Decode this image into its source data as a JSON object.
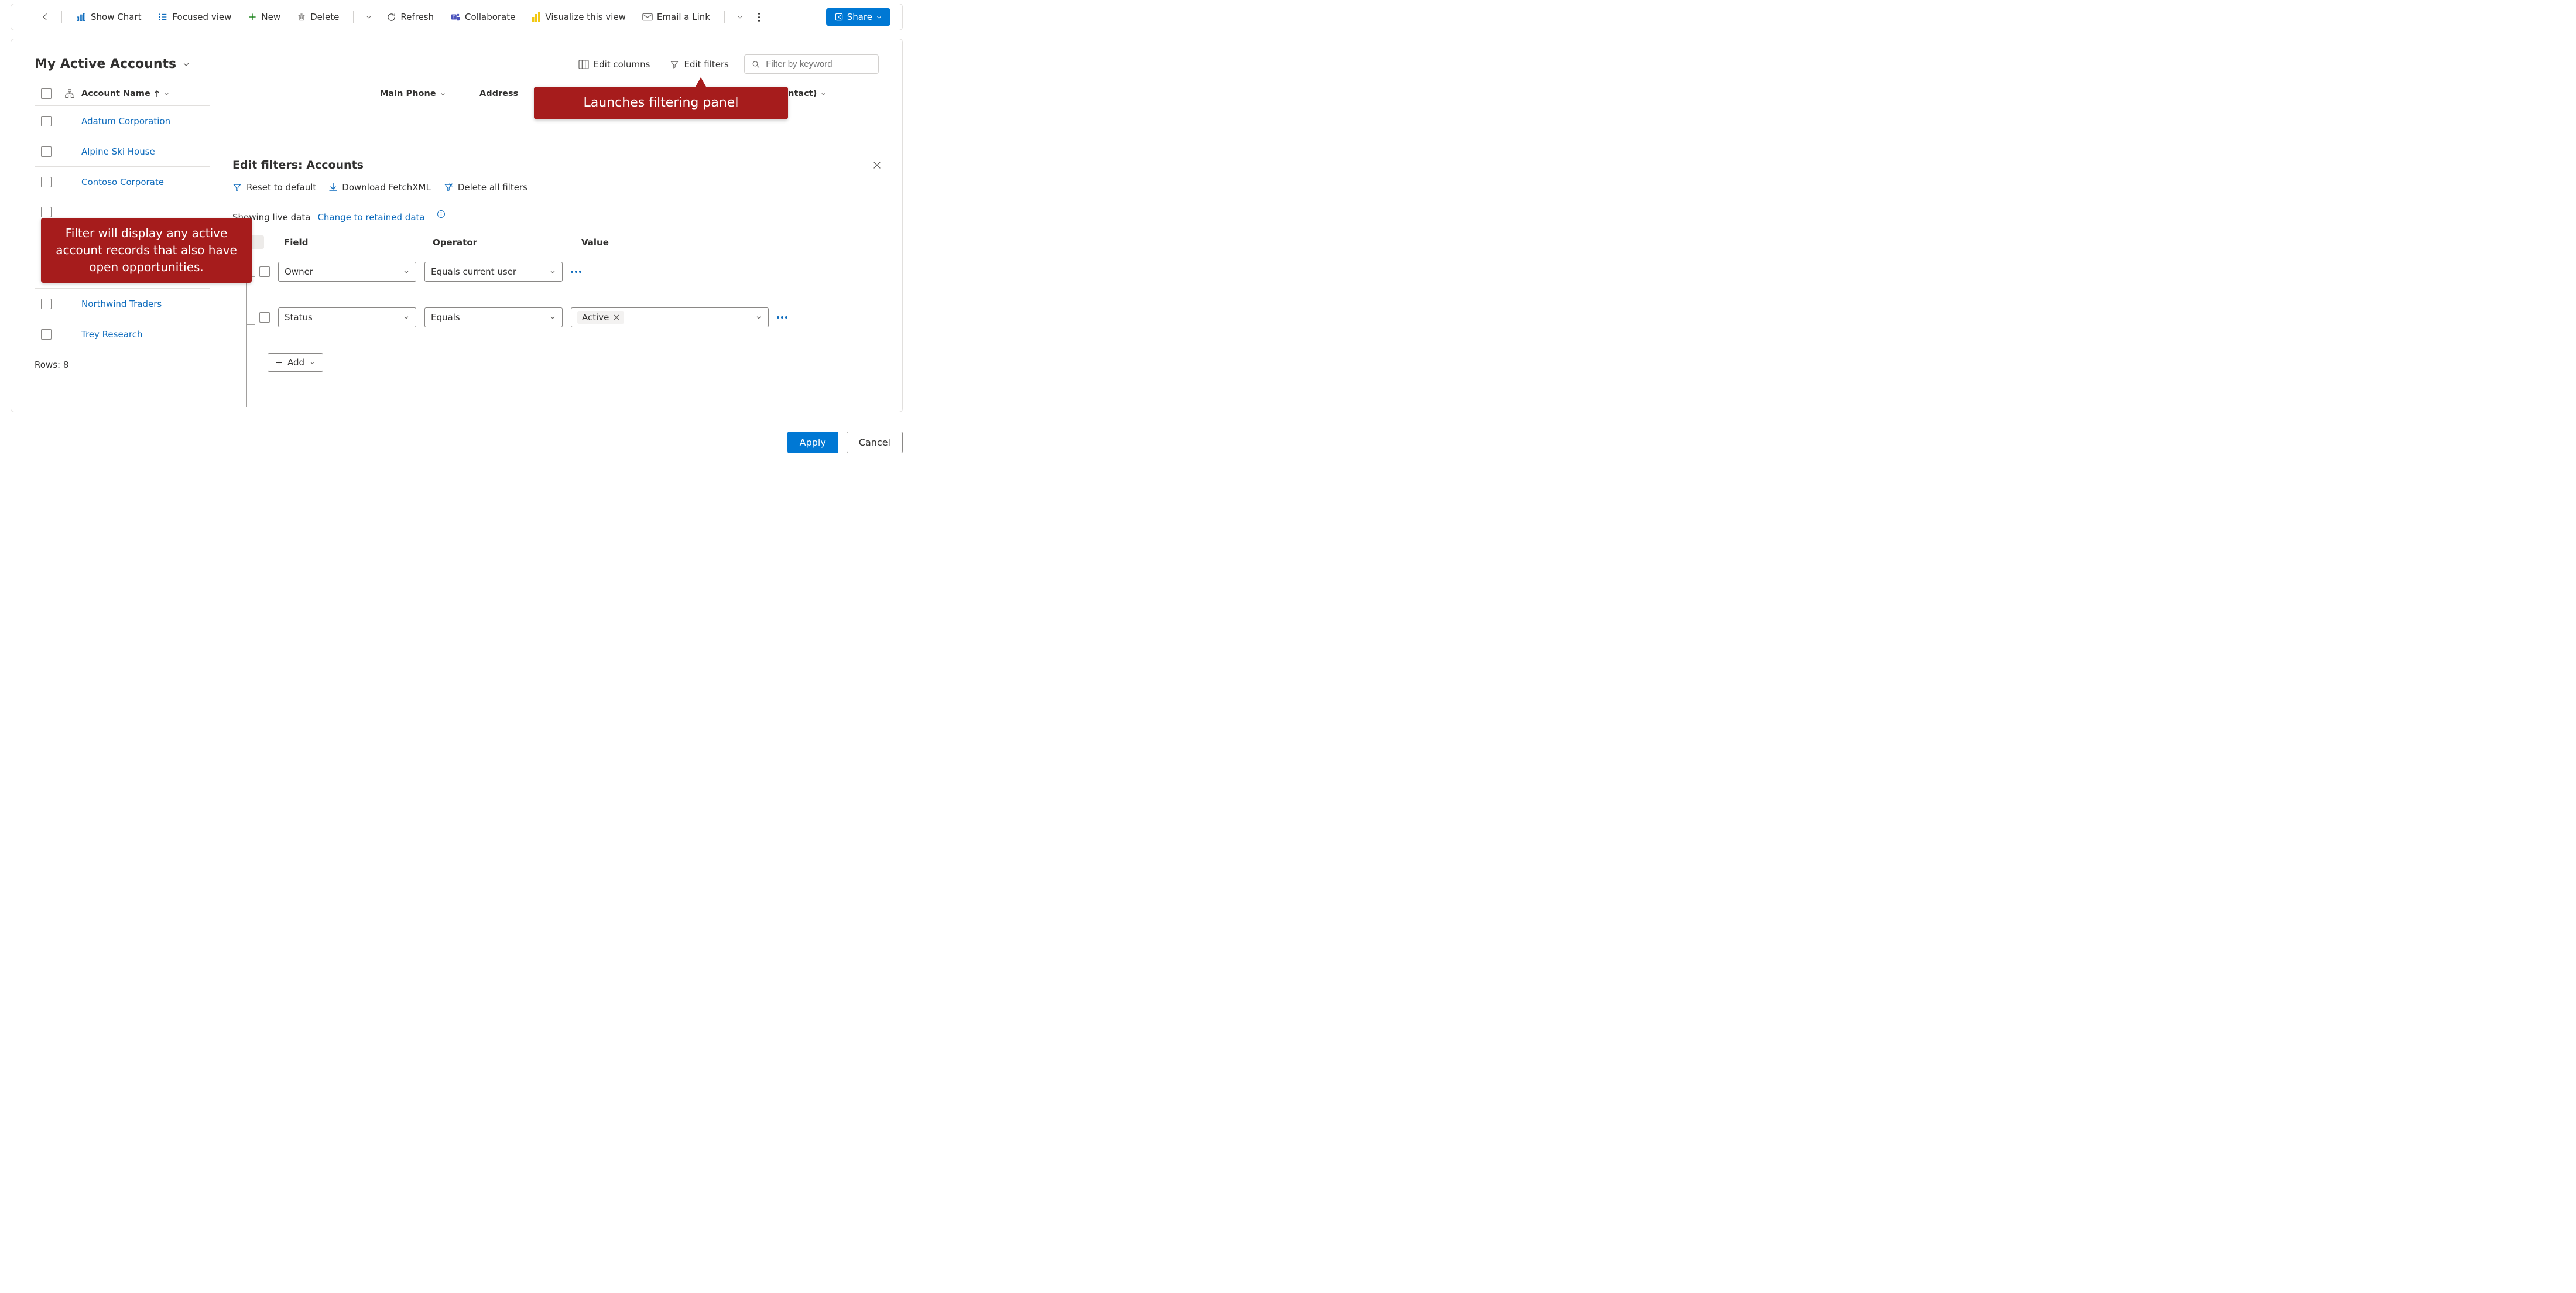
{
  "toolbar": {
    "show_chart": "Show Chart",
    "focused": "Focused view",
    "new": "New",
    "delete": "Delete",
    "refresh": "Refresh",
    "collab": "Collaborate",
    "visualize": "Visualize this view",
    "email": "Email a Link",
    "share": "Share"
  },
  "view": {
    "title": "My Active Accounts",
    "edit_cols": "Edit columns",
    "edit_filters": "Edit filters",
    "search_placeholder": "Filter by keyword"
  },
  "columns": {
    "name": "Account Name",
    "phone": "Main Phone",
    "addr": "Address",
    "contact": "mary Contact)"
  },
  "rows": [
    "Adatum Corporation",
    "Alpine Ski House",
    "Contoso Corporate",
    "Northwind Traders",
    "Trey Research"
  ],
  "rows_label": "Rows: 8",
  "filterpanel": {
    "title": "Edit filters: Accounts",
    "reset": "Reset to default",
    "download": "Download FetchXML",
    "delete_all": "Delete all filters",
    "live": "Showing live data",
    "change": "Change to retained data",
    "headers": {
      "field": "Field",
      "operator": "Operator",
      "value": "Value"
    },
    "rows": [
      {
        "field": "Owner",
        "operator": "Equals current user",
        "value": ""
      },
      {
        "field": "Status",
        "operator": "Equals",
        "value": "Active"
      }
    ],
    "add": "Add"
  },
  "footer": {
    "apply": "Apply",
    "cancel": "Cancel"
  },
  "annot": {
    "top": "Launches filtering panel",
    "left": "Filter will display any active account records that also have open opportunities."
  }
}
